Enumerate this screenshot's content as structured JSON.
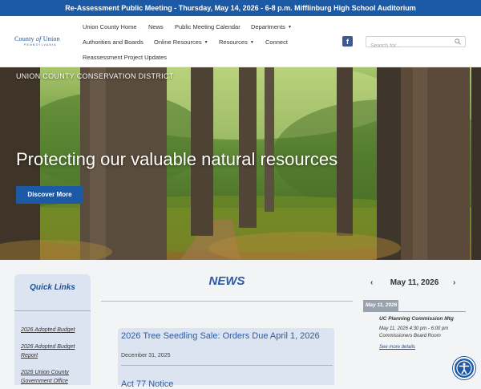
{
  "alert": {
    "text": "Re-Assessment Public Meeting - Thursday, May 14, 2026 - 6-8 p.m. Mifflinburg High School Auditorium"
  },
  "logo": {
    "name_county": "County",
    "name_of": "of",
    "name_union": "Union",
    "subtitle": "PENNSYLVANIA"
  },
  "nav": {
    "union_county_home": "Union County Home",
    "news": "News",
    "public_meeting_calendar": "Public Meeting Calendar",
    "departments": "Departments",
    "authorities_and_boards": "Authorities and Boards",
    "online_resources": "Online Resources",
    "resources": "Resources",
    "connect": "Connect",
    "reassessment_updates": "Reassessment Project Updates"
  },
  "social": {
    "facebook_glyph": "f"
  },
  "search": {
    "placeholder": "Search for...",
    "value": ""
  },
  "hero": {
    "label": "UNION COUNTY CONSERVATION DISTRICT",
    "title": "Protecting our valuable natural resources",
    "button": "Discover More"
  },
  "quick_links": {
    "title": "Quick Links",
    "items": [
      "2026 Adopted Budget",
      "2026 Adopted Budget Report",
      "2026 Union County Government Office"
    ]
  },
  "news": {
    "title": "NEWS",
    "items": [
      {
        "title": "2026 Tree Seedling Sale: Orders Due April 1, 2026",
        "date": "December 31, 2025"
      },
      {
        "title": "Act 77 Notice"
      }
    ]
  },
  "calendar": {
    "prev": "‹",
    "next": "›",
    "date": "May 11, 2026",
    "badge": "May 11, 2026",
    "event": {
      "title": "UC Planning Commission Mtg",
      "time": "May 11, 2026 4:30 pm - 6:00 pm",
      "location": "Commissioners Board Room",
      "more": "See more details"
    }
  },
  "icons": {
    "facebook": "facebook-icon",
    "search": "search-icon",
    "accessibility": "accessibility-icon",
    "caret": "chevron-down-icon"
  },
  "colors": {
    "primary": "#1c5aa6",
    "heading": "#2b5ba8",
    "panel": "#dbe4f0",
    "facebook": "#3b5998"
  }
}
